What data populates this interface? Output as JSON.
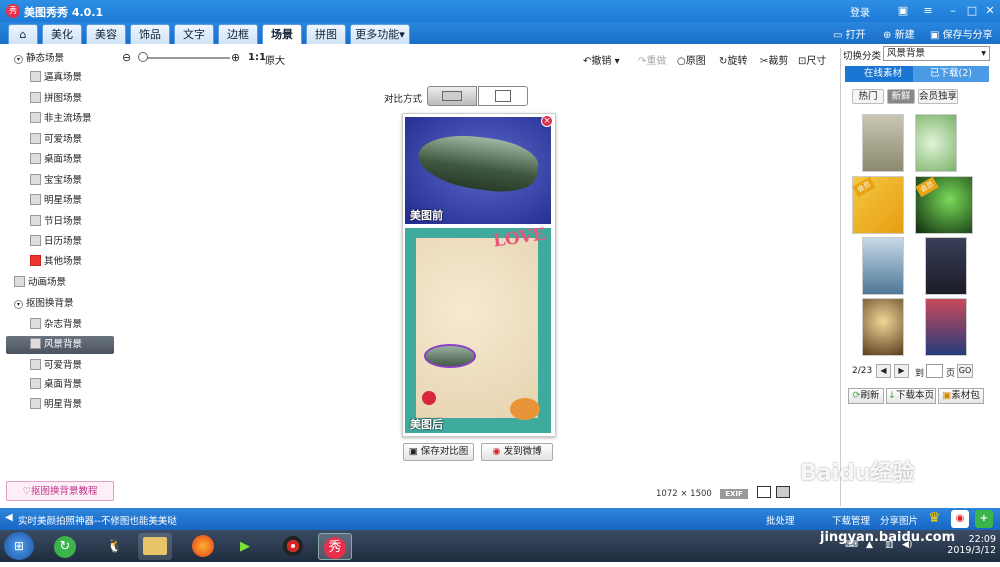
{
  "app": {
    "title": "美图秀秀 4.0.1",
    "logo": "秀",
    "login": "登录"
  },
  "tabs": [
    {
      "label": "美化"
    },
    {
      "label": "美容"
    },
    {
      "label": "饰品"
    },
    {
      "label": "文字"
    },
    {
      "label": "边框"
    },
    {
      "label": "场景"
    },
    {
      "label": "拼图"
    },
    {
      "label": "更多功能"
    }
  ],
  "topright": {
    "open": "打开",
    "new": "新建",
    "save": "保存与分享"
  },
  "toolbar": {
    "zoom_ratio": "1:1",
    "original": "原大",
    "undo": "撤销",
    "redo": "重做",
    "orig": "原图",
    "rotate": "旋转",
    "crop": "裁剪",
    "size": "尺寸"
  },
  "tree": {
    "static": "静态场景",
    "static_items": [
      "逼真场景",
      "拼图场景",
      "非主流场景",
      "可爱场景",
      "桌面场景",
      "宝宝场景",
      "明星场景",
      "节日场景",
      "日历场景",
      "其他场景"
    ],
    "animated": "动画场景",
    "cutout": "抠图换背景",
    "cutout_items": [
      "杂志背景",
      "风景背景",
      "可爱背景",
      "桌面背景",
      "明星背景"
    ],
    "tutorial": "抠图换背景教程"
  },
  "compare": {
    "label": "对比方式",
    "before": "美图前",
    "after": "美图后",
    "love": "LOVE",
    "save_btn": "保存对比图",
    "share_btn": "发到微博"
  },
  "image": {
    "width": "1072",
    "x": "×",
    "height": "1500",
    "exif": "EXIF"
  },
  "rpanel": {
    "label": "切换分类",
    "category": "风景背景",
    "tab_online": "在线素材",
    "tab_downloaded": "已下载(2)",
    "chips": [
      "热门",
      "新鲜",
      "会员独享"
    ],
    "badge": "会员",
    "page": "2/23",
    "goto": "到",
    "page_unit": "页",
    "go": "GO",
    "refresh": "刷新",
    "download_page": "下载本页",
    "pack": "素材包"
  },
  "status": {
    "tip": "实时美颜拍照神器--不修图也能美美哒",
    "batch": "批处理",
    "download_mgr": "下载管理",
    "share": "分享图片"
  },
  "taskbar": {
    "time": "22:09",
    "date": "2019/3/12"
  },
  "watermark": {
    "logo": "Baidu经验",
    "url": "jingyan.baidu.com"
  }
}
